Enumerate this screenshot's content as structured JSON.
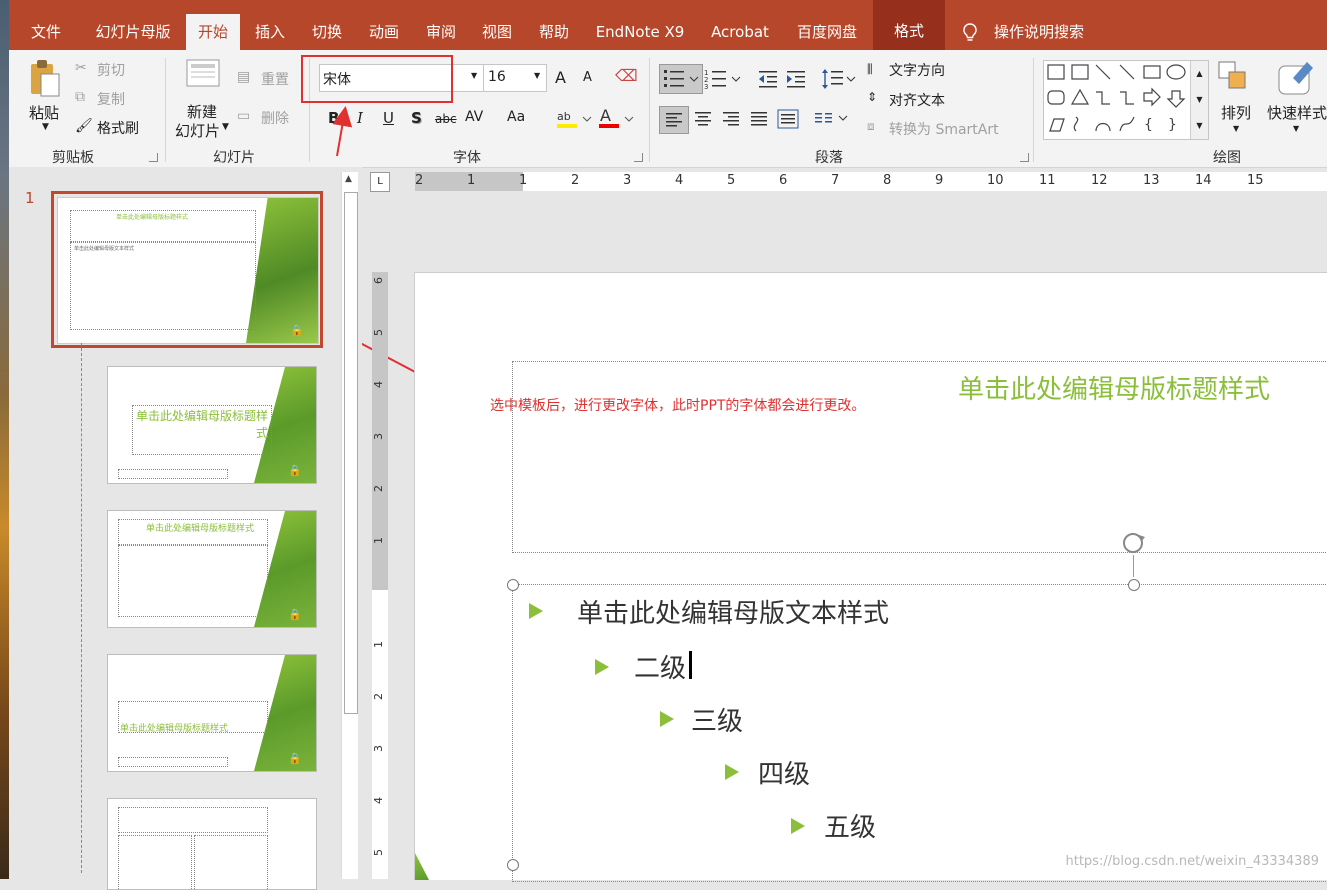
{
  "tabs": [
    "文件",
    "幻灯片母版",
    "开始",
    "插入",
    "切换",
    "动画",
    "审阅",
    "视图",
    "帮助",
    "EndNote X9",
    "Acrobat",
    "百度网盘",
    "格式"
  ],
  "active_tab": "开始",
  "tell_me": "操作说明搜索",
  "clipboard": {
    "paste": "粘贴",
    "cut": "剪切",
    "copy": "复制",
    "format_painter": "格式刷",
    "label": "剪贴板"
  },
  "slides_group": {
    "new_slide_1": "新建",
    "new_slide_2": "幻灯片",
    "reset": "重置",
    "delete": "删除",
    "label": "幻灯片"
  },
  "font": {
    "name": "宋体",
    "size": "16",
    "label": "字体",
    "bold": "B",
    "italic": "I",
    "underline": "U",
    "shadow": "S",
    "strike": "abc",
    "spacing": "AV",
    "case": "Aa",
    "grow": "A",
    "shrink": "A"
  },
  "paragraph": {
    "text_direction": "文字方向",
    "align_text": "对齐文本",
    "smartart": "转换为 SmartArt",
    "label": "段落"
  },
  "drawing": {
    "arrange": "排列",
    "quick_styles": "快速样式",
    "label": "绘图"
  },
  "slide_number": "1",
  "thumb_titles": [
    "单击此处编辑母版标题样式",
    "单击此处编辑母版标题样式",
    "单击此处编辑母版标题样式",
    "单击此处编辑母版标题样式"
  ],
  "thumb_sub": "单击此处编辑母版文本样式",
  "ruler_h": [
    "2",
    "1",
    "1",
    "2",
    "3",
    "4",
    "5",
    "6",
    "7",
    "8",
    "9",
    "10",
    "11",
    "12",
    "13",
    "14",
    "15"
  ],
  "ruler_v": [
    "6",
    "5",
    "4",
    "3",
    "2",
    "1",
    "",
    "1",
    "2",
    "3",
    "4",
    "5"
  ],
  "slide": {
    "title": "单击此处编辑母版标题样式",
    "levels": [
      "单击此处编辑母版文本样式",
      "二级",
      "三级",
      "四级",
      "五级"
    ]
  },
  "annotation": "选中模板后，进行更改字体，此时PPT的字体都会进行更改。",
  "watermark": "https://blog.csdn.net/weixin_43334389",
  "colors": {
    "accent": "#b7472a",
    "title_green": "#8bbf3a",
    "annotation": "#e03030"
  }
}
